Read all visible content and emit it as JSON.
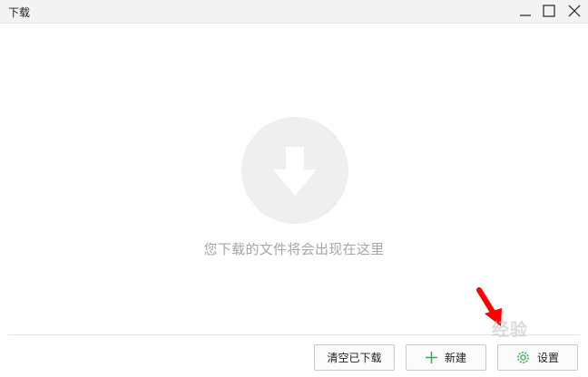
{
  "window": {
    "title": "下载",
    "controls": [
      "minimize-icon",
      "maximize-icon",
      "close-icon"
    ]
  },
  "empty_state": {
    "icon": "download-arrow-icon",
    "message": "您下载的文件将会出现在这里"
  },
  "footer": {
    "clear_label": "清空已下载",
    "new_label": "新建",
    "new_icon": "plus-icon",
    "settings_label": "设置",
    "settings_icon": "gear-icon"
  },
  "annotation": {
    "arrow_color": "#ff0000",
    "watermark": "经验"
  },
  "colors": {
    "accent_green": "#2bb24c",
    "empty_icon_bg": "#efefef",
    "empty_text": "#a6a6a6"
  }
}
